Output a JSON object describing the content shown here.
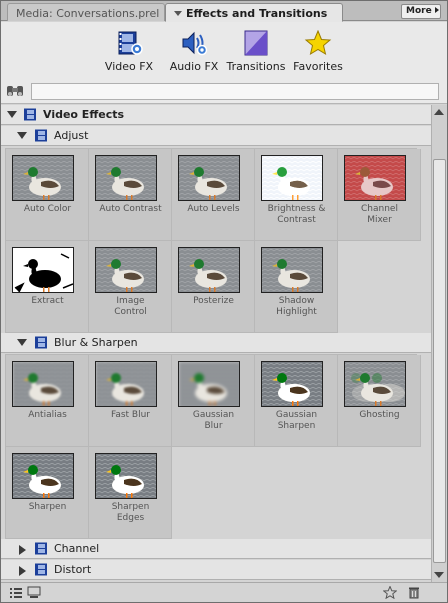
{
  "tabs": {
    "media_tab": "Media: Conversations.prel",
    "effects_tab": "Effects and Transitions",
    "more_button": "More"
  },
  "categories": [
    {
      "label": "Video FX",
      "icon": "video-fx-icon"
    },
    {
      "label": "Audio FX",
      "icon": "audio-fx-icon"
    },
    {
      "label": "Transitions",
      "icon": "transitions-icon"
    },
    {
      "label": "Favorites",
      "icon": "favorites-star-icon"
    }
  ],
  "search": {
    "value": "",
    "placeholder": ""
  },
  "sections": {
    "video_effects": "Video Effects",
    "adjust": "Adjust",
    "blur_sharpen": "Blur & Sharpen",
    "channel": "Channel",
    "distort": "Distort"
  },
  "adjust_effects": [
    {
      "name": "Auto Color",
      "look": "normal"
    },
    {
      "name": "Auto Contrast",
      "look": "normal"
    },
    {
      "name": "Auto Levels",
      "look": "normal"
    },
    {
      "name": "Brightness &\nContrast",
      "look": "bright"
    },
    {
      "name": "Channel\nMixer",
      "look": "red"
    },
    {
      "name": "Extract",
      "look": "extract"
    },
    {
      "name": "Image\nControl",
      "look": "normal"
    },
    {
      "name": "Posterize",
      "look": "normal"
    },
    {
      "name": "Shadow\nHighlight",
      "look": "normal"
    }
  ],
  "blur_effects": [
    {
      "name": "Antialias",
      "look": "blur"
    },
    {
      "name": "Fast Blur",
      "look": "blur"
    },
    {
      "name": "Gaussian\nBlur",
      "look": "blur2"
    },
    {
      "name": "Gaussian\nSharpen",
      "look": "sharp"
    },
    {
      "name": "Ghosting",
      "look": "ghost"
    },
    {
      "name": "Sharpen",
      "look": "sharp"
    },
    {
      "name": "Sharpen\nEdges",
      "look": "sharp"
    }
  ],
  "colors": {
    "panel_bg": "#d4d4d4",
    "cell_bg": "#c6c6c6",
    "icon_blue": "#1c3f9a"
  }
}
